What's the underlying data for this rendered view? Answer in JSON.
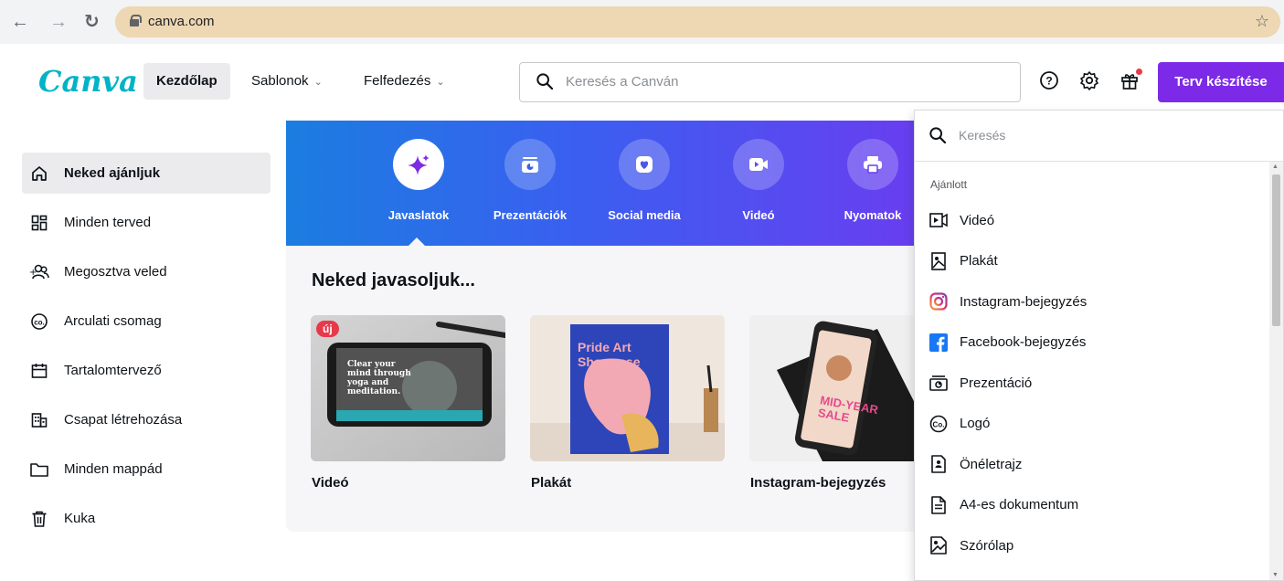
{
  "browser": {
    "url": "canva.com",
    "back_icon": "arrow-left-icon",
    "forward_icon": "arrow-right-icon",
    "reload_icon": "reload-icon"
  },
  "header": {
    "logo": "Canva",
    "nav": [
      {
        "label": "Kezdőlap",
        "active": true
      },
      {
        "label": "Sablonok",
        "chevron": true
      },
      {
        "label": "Felfedezés",
        "chevron": true
      }
    ],
    "search_placeholder": "Keresés a Canván",
    "create_button": "Terv készítése",
    "colors": {
      "brand": "#00b3c7",
      "accent": "#7d2ae8"
    }
  },
  "sidebar": {
    "items": [
      {
        "label": "Neked ajánljuk",
        "icon": "home-icon",
        "active": true
      },
      {
        "label": "Minden terved",
        "icon": "grid-icon"
      },
      {
        "label": "Megosztva veled",
        "icon": "shared-users-icon"
      },
      {
        "label": "Arculati csomag",
        "icon": "brand-kit-icon"
      },
      {
        "label": "Tartalomtervező",
        "icon": "calendar-icon"
      },
      {
        "label": "Csapat létrehozása",
        "icon": "team-building-icon"
      },
      {
        "label": "Minden mappád",
        "icon": "folder-icon"
      },
      {
        "label": "Kuka",
        "icon": "trash-icon"
      }
    ]
  },
  "main": {
    "categories": [
      {
        "label": "Javaslatok",
        "icon": "sparkle-icon",
        "active": true
      },
      {
        "label": "Prezentációk",
        "icon": "presentation-icon"
      },
      {
        "label": "Social media",
        "icon": "heart-icon"
      },
      {
        "label": "Videó",
        "icon": "video-camera-icon"
      },
      {
        "label": "Nyomatok",
        "icon": "printer-icon"
      }
    ],
    "section_title": "Neked javasoljuk...",
    "cards": [
      {
        "label": "Videó",
        "badge": "új",
        "thumb_text": "Clear your mind through yoga and meditation."
      },
      {
        "label": "Plakát",
        "thumb_text": "Pride Art Showcase"
      },
      {
        "label": "Instagram-bejegyzés",
        "thumb_text": "MID-YEAR SALE"
      }
    ]
  },
  "dropdown": {
    "search_placeholder": "Keresés",
    "section_label": "Ajánlott",
    "items": [
      {
        "label": "Videó",
        "icon": "video-icon"
      },
      {
        "label": "Plakát",
        "icon": "poster-icon"
      },
      {
        "label": "Instagram-bejegyzés",
        "icon": "instagram-icon"
      },
      {
        "label": "Facebook-bejegyzés",
        "icon": "facebook-icon"
      },
      {
        "label": "Prezentáció",
        "icon": "presentation-icon"
      },
      {
        "label": "Logó",
        "icon": "logo-icon"
      },
      {
        "label": "Önéletrajz",
        "icon": "resume-icon"
      },
      {
        "label": "A4-es dokumentum",
        "icon": "document-icon"
      },
      {
        "label": "Szórólap",
        "icon": "flyer-icon"
      }
    ]
  }
}
